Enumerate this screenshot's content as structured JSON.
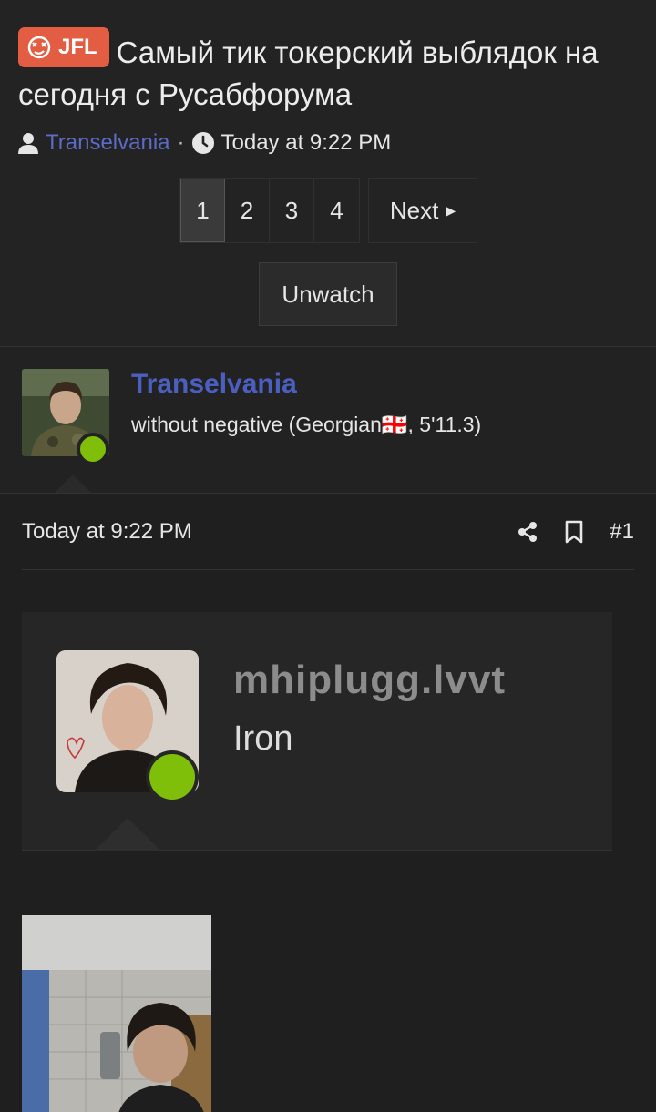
{
  "thread": {
    "prefix": "JFL",
    "title": "Самый тик токерский выблядок на сегодня с Русабфорума",
    "author": "Transelvania",
    "separator": "·",
    "time": "Today at 9:22 PM"
  },
  "pagination": {
    "pages": [
      "1",
      "2",
      "3",
      "4"
    ],
    "current": "1",
    "next_label": "Next"
  },
  "watch": {
    "label": "Unwatch"
  },
  "post_user": {
    "name": "Transelvania",
    "title": "without negative (Georgian🇬🇪, 5'11.3)"
  },
  "post": {
    "date": "Today at 9:22 PM",
    "number": "#1",
    "embed": {
      "name": "mhiplugg.lvvt",
      "title": "Iron"
    }
  },
  "colors": {
    "prefix_bg": "#e35d42",
    "link": "#5c6bc7",
    "username": "#4a5fbf",
    "online": "#7fbf0a",
    "background": "#232323"
  }
}
